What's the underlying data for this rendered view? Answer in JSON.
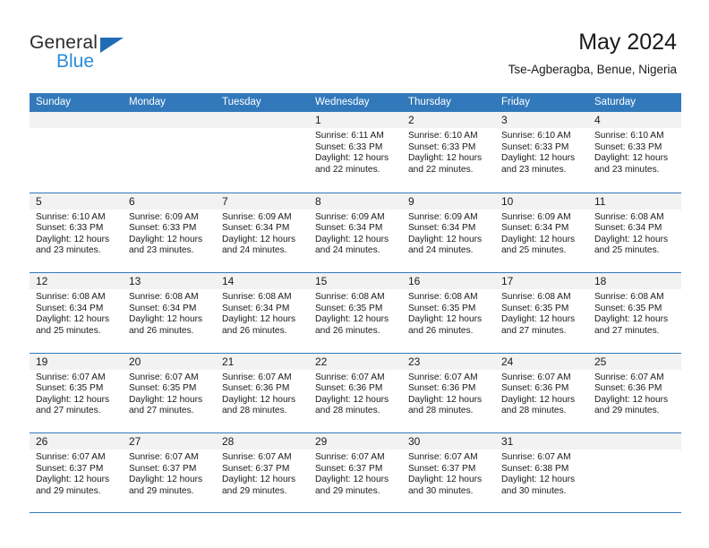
{
  "brand": {
    "name_top": "General",
    "name_bottom": "Blue",
    "triangle_color": "#1f6cb4",
    "blue_color": "#2a8bd8"
  },
  "header": {
    "title": "May 2024",
    "subtitle": "Tse-Agberagba, Benue, Nigeria"
  },
  "theme": {
    "header_blue": "#3279bb",
    "daynum_band": "#f2f2f2",
    "text": "#1a1a1a"
  },
  "weekdays": [
    "Sunday",
    "Monday",
    "Tuesday",
    "Wednesday",
    "Thursday",
    "Friday",
    "Saturday"
  ],
  "labels": {
    "sunrise_prefix": "Sunrise:",
    "sunset_prefix": "Sunset:",
    "daylight_prefix": "Daylight:"
  },
  "weeks": [
    [
      {
        "day": "",
        "empty": true
      },
      {
        "day": "",
        "empty": true
      },
      {
        "day": "",
        "empty": true
      },
      {
        "day": "1",
        "sunrise": "Sunrise: 6:11 AM",
        "sunset": "Sunset: 6:33 PM",
        "daylight": "Daylight: 12 hours and 22 minutes."
      },
      {
        "day": "2",
        "sunrise": "Sunrise: 6:10 AM",
        "sunset": "Sunset: 6:33 PM",
        "daylight": "Daylight: 12 hours and 22 minutes."
      },
      {
        "day": "3",
        "sunrise": "Sunrise: 6:10 AM",
        "sunset": "Sunset: 6:33 PM",
        "daylight": "Daylight: 12 hours and 23 minutes."
      },
      {
        "day": "4",
        "sunrise": "Sunrise: 6:10 AM",
        "sunset": "Sunset: 6:33 PM",
        "daylight": "Daylight: 12 hours and 23 minutes."
      }
    ],
    [
      {
        "day": "5",
        "sunrise": "Sunrise: 6:10 AM",
        "sunset": "Sunset: 6:33 PM",
        "daylight": "Daylight: 12 hours and 23 minutes."
      },
      {
        "day": "6",
        "sunrise": "Sunrise: 6:09 AM",
        "sunset": "Sunset: 6:33 PM",
        "daylight": "Daylight: 12 hours and 23 minutes."
      },
      {
        "day": "7",
        "sunrise": "Sunrise: 6:09 AM",
        "sunset": "Sunset: 6:34 PM",
        "daylight": "Daylight: 12 hours and 24 minutes."
      },
      {
        "day": "8",
        "sunrise": "Sunrise: 6:09 AM",
        "sunset": "Sunset: 6:34 PM",
        "daylight": "Daylight: 12 hours and 24 minutes."
      },
      {
        "day": "9",
        "sunrise": "Sunrise: 6:09 AM",
        "sunset": "Sunset: 6:34 PM",
        "daylight": "Daylight: 12 hours and 24 minutes."
      },
      {
        "day": "10",
        "sunrise": "Sunrise: 6:09 AM",
        "sunset": "Sunset: 6:34 PM",
        "daylight": "Daylight: 12 hours and 25 minutes."
      },
      {
        "day": "11",
        "sunrise": "Sunrise: 6:08 AM",
        "sunset": "Sunset: 6:34 PM",
        "daylight": "Daylight: 12 hours and 25 minutes."
      }
    ],
    [
      {
        "day": "12",
        "sunrise": "Sunrise: 6:08 AM",
        "sunset": "Sunset: 6:34 PM",
        "daylight": "Daylight: 12 hours and 25 minutes."
      },
      {
        "day": "13",
        "sunrise": "Sunrise: 6:08 AM",
        "sunset": "Sunset: 6:34 PM",
        "daylight": "Daylight: 12 hours and 26 minutes."
      },
      {
        "day": "14",
        "sunrise": "Sunrise: 6:08 AM",
        "sunset": "Sunset: 6:34 PM",
        "daylight": "Daylight: 12 hours and 26 minutes."
      },
      {
        "day": "15",
        "sunrise": "Sunrise: 6:08 AM",
        "sunset": "Sunset: 6:35 PM",
        "daylight": "Daylight: 12 hours and 26 minutes."
      },
      {
        "day": "16",
        "sunrise": "Sunrise: 6:08 AM",
        "sunset": "Sunset: 6:35 PM",
        "daylight": "Daylight: 12 hours and 26 minutes."
      },
      {
        "day": "17",
        "sunrise": "Sunrise: 6:08 AM",
        "sunset": "Sunset: 6:35 PM",
        "daylight": "Daylight: 12 hours and 27 minutes."
      },
      {
        "day": "18",
        "sunrise": "Sunrise: 6:08 AM",
        "sunset": "Sunset: 6:35 PM",
        "daylight": "Daylight: 12 hours and 27 minutes."
      }
    ],
    [
      {
        "day": "19",
        "sunrise": "Sunrise: 6:07 AM",
        "sunset": "Sunset: 6:35 PM",
        "daylight": "Daylight: 12 hours and 27 minutes."
      },
      {
        "day": "20",
        "sunrise": "Sunrise: 6:07 AM",
        "sunset": "Sunset: 6:35 PM",
        "daylight": "Daylight: 12 hours and 27 minutes."
      },
      {
        "day": "21",
        "sunrise": "Sunrise: 6:07 AM",
        "sunset": "Sunset: 6:36 PM",
        "daylight": "Daylight: 12 hours and 28 minutes."
      },
      {
        "day": "22",
        "sunrise": "Sunrise: 6:07 AM",
        "sunset": "Sunset: 6:36 PM",
        "daylight": "Daylight: 12 hours and 28 minutes."
      },
      {
        "day": "23",
        "sunrise": "Sunrise: 6:07 AM",
        "sunset": "Sunset: 6:36 PM",
        "daylight": "Daylight: 12 hours and 28 minutes."
      },
      {
        "day": "24",
        "sunrise": "Sunrise: 6:07 AM",
        "sunset": "Sunset: 6:36 PM",
        "daylight": "Daylight: 12 hours and 28 minutes."
      },
      {
        "day": "25",
        "sunrise": "Sunrise: 6:07 AM",
        "sunset": "Sunset: 6:36 PM",
        "daylight": "Daylight: 12 hours and 29 minutes."
      }
    ],
    [
      {
        "day": "26",
        "sunrise": "Sunrise: 6:07 AM",
        "sunset": "Sunset: 6:37 PM",
        "daylight": "Daylight: 12 hours and 29 minutes."
      },
      {
        "day": "27",
        "sunrise": "Sunrise: 6:07 AM",
        "sunset": "Sunset: 6:37 PM",
        "daylight": "Daylight: 12 hours and 29 minutes."
      },
      {
        "day": "28",
        "sunrise": "Sunrise: 6:07 AM",
        "sunset": "Sunset: 6:37 PM",
        "daylight": "Daylight: 12 hours and 29 minutes."
      },
      {
        "day": "29",
        "sunrise": "Sunrise: 6:07 AM",
        "sunset": "Sunset: 6:37 PM",
        "daylight": "Daylight: 12 hours and 29 minutes."
      },
      {
        "day": "30",
        "sunrise": "Sunrise: 6:07 AM",
        "sunset": "Sunset: 6:37 PM",
        "daylight": "Daylight: 12 hours and 30 minutes."
      },
      {
        "day": "31",
        "sunrise": "Sunrise: 6:07 AM",
        "sunset": "Sunset: 6:38 PM",
        "daylight": "Daylight: 12 hours and 30 minutes."
      },
      {
        "day": "",
        "empty": true
      }
    ]
  ]
}
